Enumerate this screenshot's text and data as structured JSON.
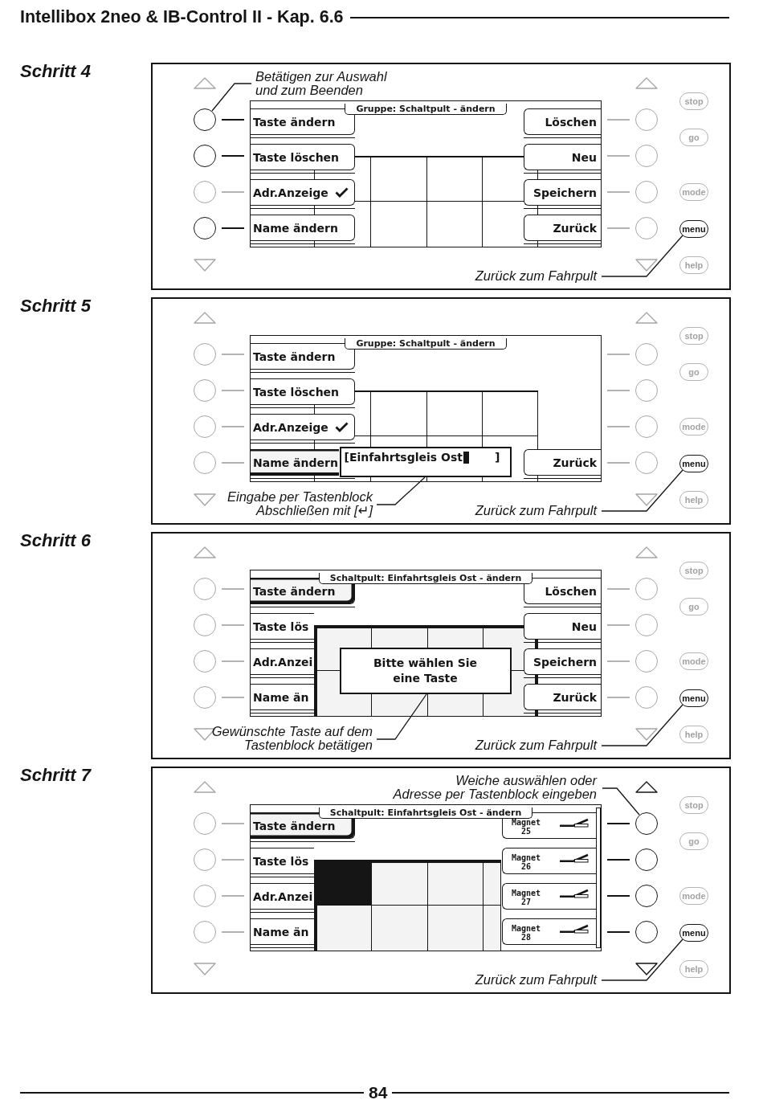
{
  "header": {
    "title": "Intellibox 2neo & IB-Control II - Kap. 6.6"
  },
  "steps": [
    {
      "label": "Schritt 4",
      "device": {
        "left_side": {
          "up_highlighted": false,
          "buttons": [
            {
              "highlighted": true
            },
            {
              "highlighted": true
            },
            {
              "highlighted": false
            },
            {
              "highlighted": true
            }
          ],
          "down_highlighted": false
        },
        "right_side": {
          "up_highlighted": false,
          "buttons": [
            {
              "highlighted": false
            },
            {
              "highlighted": false
            },
            {
              "highlighted": false
            },
            {
              "highlighted": false
            }
          ],
          "down_highlighted": false
        },
        "function_keys": [
          {
            "label": "stop",
            "highlighted": false
          },
          {
            "label": "go",
            "highlighted": false
          },
          {
            "label": "mode",
            "highlighted": false
          },
          {
            "label": "menu",
            "highlighted": true
          },
          {
            "label": "help",
            "highlighted": false
          }
        ],
        "screen": {
          "title": "Gruppe: Schaltpult - ändern",
          "rows": [
            {
              "left": {
                "label": "Taste ändern",
                "selected": false
              },
              "right": {
                "kind": "text",
                "label": "Löschen"
              }
            },
            {
              "left": {
                "label": "Taste löschen",
                "selected": false
              },
              "right": {
                "kind": "text",
                "label": "Neu"
              }
            },
            {
              "left": {
                "label": "Adr.Anzeige",
                "checked": true,
                "selected": false
              },
              "right": {
                "kind": "text",
                "label": "Speichern"
              }
            },
            {
              "left": {
                "label": "Name ändern",
                "selected": false
              },
              "right": {
                "kind": "text",
                "label": "Zurück"
              }
            }
          ],
          "track_grid": {
            "focused": false
          }
        },
        "callouts": [
          {
            "kind": "left",
            "lines": [
              "Betätigen zur Auswahl",
              "und zum Beenden"
            ]
          },
          {
            "kind": "menu",
            "lines": [
              "Zurück zum Fahrpult"
            ]
          }
        ]
      }
    },
    {
      "label": "Schritt 5",
      "device": {
        "left_side": {
          "up_highlighted": false,
          "buttons": [
            {
              "highlighted": false
            },
            {
              "highlighted": false
            },
            {
              "highlighted": false
            },
            {
              "highlighted": false
            }
          ],
          "down_highlighted": false
        },
        "right_side": {
          "up_highlighted": false,
          "buttons": [
            {
              "highlighted": false
            },
            {
              "highlighted": false
            },
            {
              "highlighted": false
            },
            {
              "highlighted": false
            }
          ],
          "down_highlighted": false
        },
        "function_keys": [
          {
            "label": "stop",
            "highlighted": false
          },
          {
            "label": "go",
            "highlighted": false
          },
          {
            "label": "mode",
            "highlighted": false
          },
          {
            "label": "menu",
            "highlighted": true
          },
          {
            "label": "help",
            "highlighted": false
          }
        ],
        "screen": {
          "title": "Gruppe: Schaltpult - ändern",
          "rows": [
            {
              "left": {
                "label": "Taste ändern",
                "selected": false
              }
            },
            {
              "left": {
                "label": "Taste löschen",
                "selected": false
              }
            },
            {
              "left": {
                "label": "Adr.Anzeige",
                "checked": true,
                "selected": false
              }
            },
            {
              "left": {
                "label": "Name ändern",
                "selected": true
              },
              "right": {
                "kind": "text",
                "label": "Zurück"
              }
            }
          ],
          "track_grid": {
            "focused": false
          },
          "name_field": {
            "value": "[Einfahrtsgleis Ost",
            "cursor": true,
            "closing": "]"
          }
        },
        "callouts": [
          {
            "kind": "field",
            "lines": [
              "Eingabe per Tastenblock",
              "Abschließen mit [↵]"
            ]
          },
          {
            "kind": "menu",
            "lines": [
              "Zurück zum Fahrpult"
            ]
          }
        ]
      }
    },
    {
      "label": "Schritt 6",
      "device": {
        "left_side": {
          "up_highlighted": false,
          "buttons": [
            {
              "highlighted": false
            },
            {
              "highlighted": false
            },
            {
              "highlighted": false
            },
            {
              "highlighted": false
            }
          ],
          "down_highlighted": false
        },
        "right_side": {
          "up_highlighted": false,
          "buttons": [
            {
              "highlighted": false
            },
            {
              "highlighted": false
            },
            {
              "highlighted": false
            },
            {
              "highlighted": false
            }
          ],
          "down_highlighted": false
        },
        "function_keys": [
          {
            "label": "stop",
            "highlighted": false
          },
          {
            "label": "go",
            "highlighted": false
          },
          {
            "label": "mode",
            "highlighted": false
          },
          {
            "label": "menu",
            "highlighted": true
          },
          {
            "label": "help",
            "highlighted": false
          }
        ],
        "screen": {
          "title": "Schaltpult: Einfahrtsgleis Ost - ändern",
          "rows": [
            {
              "left": {
                "label": "Taste ändern",
                "selected": true
              },
              "right": {
                "kind": "text",
                "label": "Löschen"
              }
            },
            {
              "left": {
                "label": "Taste lös",
                "selected": false
              },
              "right": {
                "kind": "text",
                "label": "Neu"
              }
            },
            {
              "left": {
                "label": "Adr.Anzei",
                "selected": false
              },
              "right": {
                "kind": "text",
                "label": "Speichern"
              }
            },
            {
              "left": {
                "label": "Name än",
                "selected": false
              },
              "right": {
                "kind": "text",
                "label": "Zurück"
              }
            }
          ],
          "track_grid": {
            "focused": true
          },
          "dialog": {
            "lines": [
              "Bitte wählen Sie",
              "eine Taste"
            ]
          }
        },
        "callouts": [
          {
            "kind": "dialog",
            "lines": [
              "Gewünschte Taste auf dem",
              "Tastenblock betätigen"
            ]
          },
          {
            "kind": "menu",
            "lines": [
              "Zurück zum Fahrpult"
            ]
          }
        ]
      }
    },
    {
      "label": "Schritt 7",
      "device": {
        "left_side": {
          "up_highlighted": false,
          "buttons": [
            {
              "highlighted": false
            },
            {
              "highlighted": false
            },
            {
              "highlighted": false
            },
            {
              "highlighted": false
            }
          ],
          "down_highlighted": false
        },
        "right_side": {
          "up_highlighted": true,
          "buttons": [
            {
              "highlighted": true
            },
            {
              "highlighted": true
            },
            {
              "highlighted": true
            },
            {
              "highlighted": true
            }
          ],
          "down_highlighted": true
        },
        "function_keys": [
          {
            "label": "stop",
            "highlighted": false
          },
          {
            "label": "go",
            "highlighted": false
          },
          {
            "label": "mode",
            "highlighted": false
          },
          {
            "label": "menu",
            "highlighted": true
          },
          {
            "label": "help",
            "highlighted": false
          }
        ],
        "screen": {
          "title": "Schaltpult: Einfahrtsgleis Ost - ändern",
          "rows": [
            {
              "left": {
                "label": "Taste ändern",
                "selected": true
              },
              "right": {
                "kind": "magnet",
                "label": "Magnet",
                "number": "25"
              }
            },
            {
              "left": {
                "label": "Taste lös",
                "selected": false
              },
              "right": {
                "kind": "magnet",
                "label": "Magnet",
                "number": "26"
              }
            },
            {
              "left": {
                "label": "Adr.Anzei",
                "selected": false
              },
              "right": {
                "kind": "magnet",
                "label": "Magnet",
                "number": "27"
              }
            },
            {
              "left": {
                "label": "Name än",
                "selected": false
              },
              "right": {
                "kind": "magnet",
                "label": "Magnet",
                "number": "28"
              }
            }
          ],
          "track_grid": {
            "focused": true,
            "cells": [
              {
                "selected": true
              },
              {
                "selected": false
              },
              {
                "selected": false
              },
              {
                "selected": false
              },
              {
                "selected": false
              },
              {
                "selected": false
              },
              {
                "selected": false
              },
              {
                "selected": false
              }
            ]
          },
          "scrollbar": true
        },
        "callouts": [
          {
            "kind": "right",
            "lines": [
              "Weiche auswählen oder",
              "Adresse per Tastenblock eingeben"
            ]
          },
          {
            "kind": "menu",
            "lines": [
              "Zurück zum Fahrpult"
            ]
          }
        ]
      }
    }
  ],
  "footer": {
    "page_number": "84"
  }
}
